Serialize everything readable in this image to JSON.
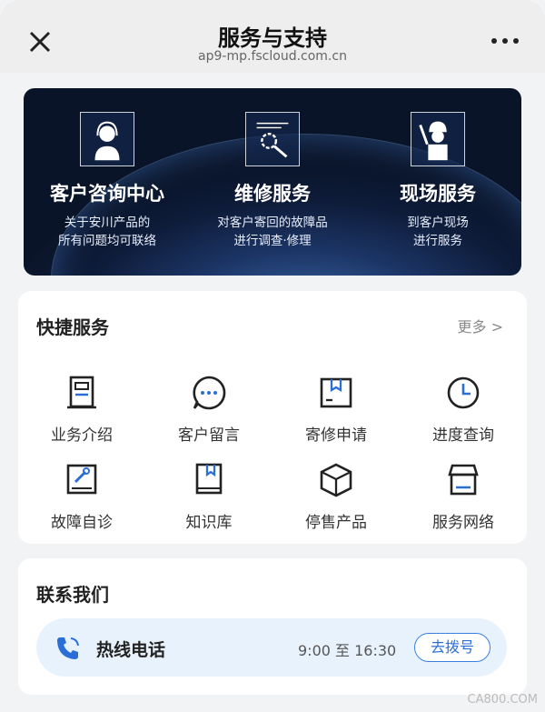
{
  "header": {
    "title": "服务与支持",
    "url": "ap9-mp.fscloud.com.cn",
    "close_icon": "close-icon",
    "more_icon": "more-dots-icon"
  },
  "banner": {
    "items": [
      {
        "title": "客户咨询中心",
        "desc_line1": "关于安川产品的",
        "desc_line2": "所有问题均可联络",
        "icon": "headset-agent-icon"
      },
      {
        "title": "维修服务",
        "desc_line1": "对客户寄回的故障品",
        "desc_line2": "进行调查·修理",
        "icon": "gear-wrench-icon"
      },
      {
        "title": "现场服务",
        "desc_line1": "到客户现场",
        "desc_line2": "进行服务",
        "icon": "technician-icon"
      }
    ]
  },
  "quick": {
    "title": "快捷服务",
    "more_label": "更多 >",
    "items": [
      {
        "label": "业务介绍",
        "icon": "document-icon"
      },
      {
        "label": "客户留言",
        "icon": "chat-bubble-icon"
      },
      {
        "label": "寄修申请",
        "icon": "package-icon"
      },
      {
        "label": "进度查询",
        "icon": "clock-icon"
      },
      {
        "label": "故障自诊",
        "icon": "wrench-screen-icon"
      },
      {
        "label": "知识库",
        "icon": "book-icon"
      },
      {
        "label": "停售产品",
        "icon": "box-icon"
      },
      {
        "label": "服务网络",
        "icon": "store-icon"
      }
    ]
  },
  "contact": {
    "title": "联系我们",
    "hotline_label": "热线电话",
    "hours": "9:00 至 16:30",
    "dial_label": "去拨号",
    "icon": "phone-icon"
  },
  "watermark": "CA800.COM",
  "colors": {
    "accent": "#2b6fd6",
    "hotline_bg": "#e8f2fd",
    "banner_dark": "#0e1c3a"
  }
}
